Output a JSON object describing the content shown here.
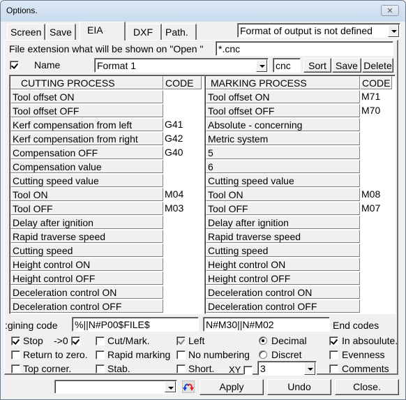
{
  "window": {
    "title": "Options.",
    "close_label": "✕"
  },
  "tabs": [
    {
      "label": "Screen",
      "active": false
    },
    {
      "label": "Save",
      "active": false
    },
    {
      "label": "EIA",
      "active": true
    },
    {
      "label": "DXF",
      "active": false
    },
    {
      "label": "Path.",
      "active": false
    }
  ],
  "output_format": {
    "selected": "Format of output is not defined"
  },
  "file_extension": {
    "label": "File extension what will be shown on \"Open \"",
    "value": "*.cnc"
  },
  "name_row": {
    "checkbox_checked": true,
    "label": "Name",
    "format_selected": "Format 1",
    "ext_value": "cnc",
    "sort_label": "Sort",
    "save_label": "Save",
    "delete_label": "Delete"
  },
  "cutting": {
    "header": "CUTTING PROCESS",
    "code_header": "CODE",
    "rows": [
      {
        "name": "Tool offset ON",
        "code": ""
      },
      {
        "name": "Tool offset OFF",
        "code": ""
      },
      {
        "name": "Kerf compensation from left",
        "code": "G41"
      },
      {
        "name": "Kerf compensation from  right",
        "code": "G42"
      },
      {
        "name": "Compensation OFF",
        "code": "G40"
      },
      {
        "name": "Compensation value",
        "code": ""
      },
      {
        "name": "Cutting speed value",
        "code": ""
      },
      {
        "name": "Tool ON",
        "code": "M04"
      },
      {
        "name": "Tool OFF",
        "code": "M03"
      },
      {
        "name": "Delay after ignition",
        "code": ""
      },
      {
        "name": "Rapid traverse speed",
        "code": ""
      },
      {
        "name": "Cutting speed",
        "code": ""
      },
      {
        "name": "Height control ON",
        "code": ""
      },
      {
        "name": "Height control OFF",
        "code": ""
      },
      {
        "name": "Deceleration control ON",
        "code": ""
      },
      {
        "name": "Deceleration control OFF",
        "code": ""
      }
    ]
  },
  "marking": {
    "header": "MARKING PROCESS",
    "code_header": "CODE",
    "rows": [
      {
        "name": "Tool offset ON",
        "code": "M71"
      },
      {
        "name": "Tool offset OFF",
        "code": "M70"
      },
      {
        "name": "Absolute - concerning",
        "code": ""
      },
      {
        "name": "Metric system",
        "code": ""
      },
      {
        "name": "5",
        "code": ""
      },
      {
        "name": "6",
        "code": ""
      },
      {
        "name": "Cutting speed value",
        "code": ""
      },
      {
        "name": "Tool ON",
        "code": "M08"
      },
      {
        "name": "Tool OFF",
        "code": "M07"
      },
      {
        "name": "Delay after ignition",
        "code": ""
      },
      {
        "name": "Rapid traverse speed",
        "code": ""
      },
      {
        "name": "Cutting speed",
        "code": ""
      },
      {
        "name": "Height control ON",
        "code": ""
      },
      {
        "name": "Height control OFF",
        "code": ""
      },
      {
        "name": "Deceleration control ON",
        "code": ""
      },
      {
        "name": "Deceleration control OFF",
        "code": ""
      }
    ]
  },
  "codes": {
    "begin_label": "gining code:",
    "begin_value": "%||N#P00$FILE$",
    "end_value": "N#M30||N#M02",
    "end_label": "End codes"
  },
  "options": {
    "stop": {
      "label": "Stop",
      "checked": true
    },
    "to_zero": {
      "label": "->0",
      "checked": true
    },
    "return_to_zero": {
      "label": "Return to zero.",
      "checked": false
    },
    "top_corner": {
      "label": "Top corner.",
      "checked": false
    },
    "cut_mark": {
      "label": "Cut/Mark.",
      "checked": false
    },
    "rapid_marking": {
      "label": "Rapid marking",
      "checked": false
    },
    "stab": {
      "label": "Stab.",
      "checked": false
    },
    "left": {
      "label": "Left",
      "checked": true,
      "disabled": true
    },
    "no_numbering": {
      "label": "No numbering",
      "checked": false
    },
    "short": {
      "label": "Short.",
      "checked": false
    },
    "xy": {
      "label": "XY",
      "checked": false
    },
    "decimal": {
      "label": "Decimal",
      "selected": true
    },
    "discret": {
      "label": "Discret",
      "selected": false
    },
    "precision": {
      "selected": "3"
    },
    "in_absolute": {
      "label": "In absoulute.",
      "checked": true
    },
    "evenness": {
      "label": "Evenness",
      "checked": false
    },
    "comments": {
      "label": "Comments",
      "checked": false
    }
  },
  "footer": {
    "combo_value": "",
    "apply_label": "Apply",
    "undo_label": "Undo",
    "close_label": "Close."
  }
}
